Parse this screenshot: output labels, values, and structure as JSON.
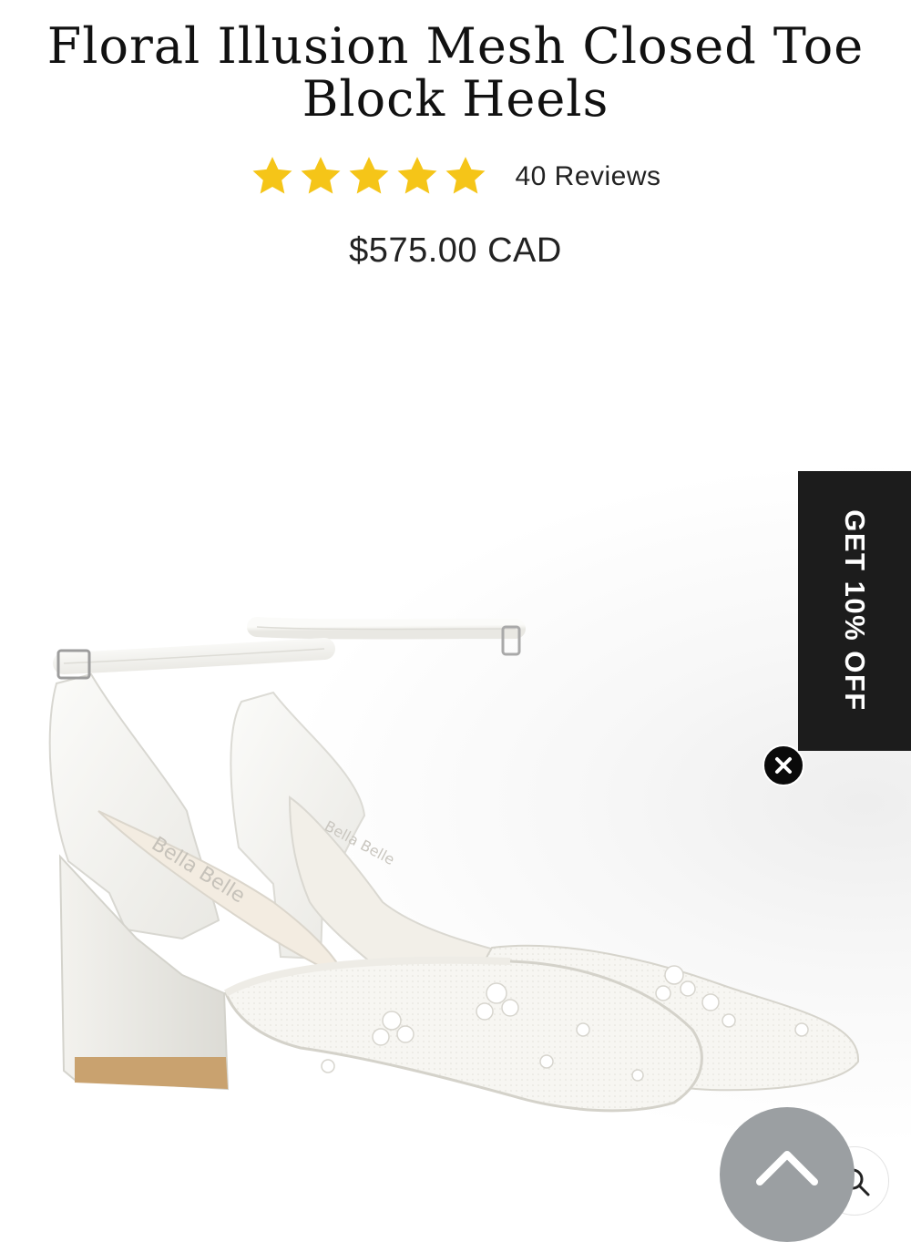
{
  "product": {
    "title_line1": "Floral Illusion Mesh Closed Toe",
    "title_line2": "Block Heels",
    "reviews_label": "40 Reviews",
    "rating": 5,
    "rating_max": 5,
    "price": "$575.00 CAD",
    "image": {
      "insole_brand_left": "Bella Belle",
      "insole_brand_right": "Bella Belle"
    }
  },
  "promo": {
    "label": "GET 10% OFF",
    "close_icon": "close-icon"
  },
  "floating": {
    "scroll_top_icon": "chevron-up-icon",
    "search_icon": "search-icon"
  },
  "colors": {
    "star": "#f5c518",
    "promo_bg": "#1c1c1c",
    "scroll_top_bg": "#9b9fa2"
  }
}
